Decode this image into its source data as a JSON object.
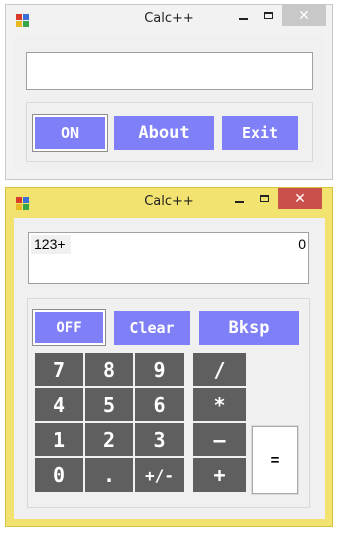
{
  "window1": {
    "title": "Calc++",
    "display_text": "",
    "buttons": {
      "on": "ON",
      "about": "About",
      "exit": "Exit"
    },
    "controls": {
      "close": "✕"
    }
  },
  "window2": {
    "title": "Calc++",
    "display": {
      "expression": "123+",
      "result": "0"
    },
    "buttons": {
      "off": "OFF",
      "clear": "Clear",
      "backspace": "Bksp",
      "equals": "="
    },
    "keys": {
      "k7": "7",
      "k8": "8",
      "k9": "9",
      "div": "/",
      "k4": "4",
      "k5": "5",
      "k6": "6",
      "mul": "*",
      "k1": "1",
      "k2": "2",
      "k3": "3",
      "sub": "–",
      "k0": "0",
      "dot": ".",
      "neg": "+/-",
      "add": "+"
    },
    "controls": {
      "close": "✕"
    }
  },
  "colors": {
    "inactive_frame": "#f2f2f2",
    "active_frame": "#f2e26f",
    "active_border": "#d6c23c",
    "close_inactive": "#c8c8c8",
    "close_active": "#c9504b",
    "purple_button": "#7f7ff7",
    "key_gray": "#5f5f5f"
  }
}
